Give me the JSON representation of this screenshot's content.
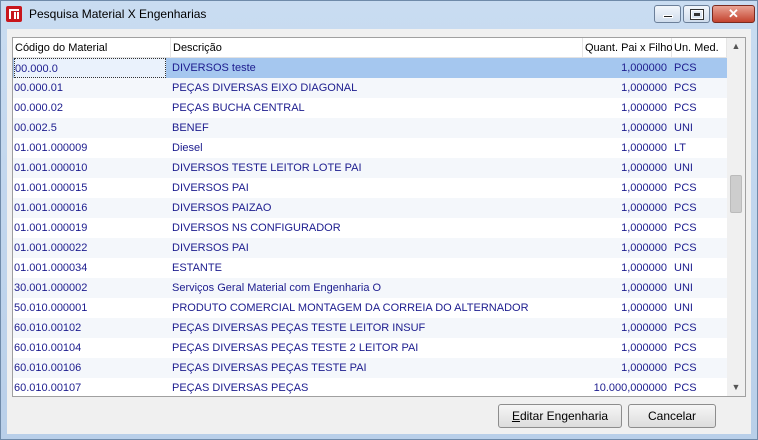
{
  "window": {
    "title": "Pesquisa Material X Engenharias",
    "close_glyph": "✕",
    "icon": "app-logo-icon"
  },
  "columns": {
    "code": "Código do Material",
    "desc": "Descrição",
    "qty": "Quant. Pai x Filho",
    "unit": "Un. Med."
  },
  "rows": [
    {
      "code": "00.000.0",
      "desc": "DIVERSOS teste",
      "qty": "1,000000",
      "unit": "PCS",
      "selected": true
    },
    {
      "code": "00.000.01",
      "desc": "PEÇAS DIVERSAS EIXO DIAGONAL",
      "qty": "1,000000",
      "unit": "PCS"
    },
    {
      "code": "00.000.02",
      "desc": "PEÇAS BUCHA CENTRAL",
      "qty": "1,000000",
      "unit": "PCS"
    },
    {
      "code": "00.002.5",
      "desc": "BENEF",
      "qty": "1,000000",
      "unit": "UNI"
    },
    {
      "code": "01.001.000009",
      "desc": "Diesel",
      "qty": "1,000000",
      "unit": "LT"
    },
    {
      "code": "01.001.000010",
      "desc": "DIVERSOS TESTE LEITOR LOTE PAI",
      "qty": "1,000000",
      "unit": "UNI"
    },
    {
      "code": "01.001.000015",
      "desc": "DIVERSOS PAI",
      "qty": "1,000000",
      "unit": "PCS"
    },
    {
      "code": "01.001.000016",
      "desc": "DIVERSOS PAIZAO",
      "qty": "1,000000",
      "unit": "PCS"
    },
    {
      "code": "01.001.000019",
      "desc": "DIVERSOS NS CONFIGURADOR",
      "qty": "1,000000",
      "unit": "PCS"
    },
    {
      "code": "01.001.000022",
      "desc": "DIVERSOS PAI",
      "qty": "1,000000",
      "unit": "PCS"
    },
    {
      "code": "01.001.000034",
      "desc": "ESTANTE",
      "qty": "1,000000",
      "unit": "UNI"
    },
    {
      "code": "30.001.000002",
      "desc": "Serviços Geral Material com Engenharia O",
      "qty": "1,000000",
      "unit": "UNI"
    },
    {
      "code": "50.010.000001",
      "desc": "PRODUTO COMERCIAL MONTAGEM DA CORREIA DO ALTERNADOR",
      "qty": "1,000000",
      "unit": "UNI"
    },
    {
      "code": "60.010.00102",
      "desc": "PEÇAS DIVERSAS PEÇAS TESTE LEITOR INSUF",
      "qty": "1,000000",
      "unit": "PCS"
    },
    {
      "code": "60.010.00104",
      "desc": "PEÇAS DIVERSAS PEÇAS TESTE 2 LEITOR PAI",
      "qty": "1,000000",
      "unit": "PCS"
    },
    {
      "code": "60.010.00106",
      "desc": "PEÇAS DIVERSAS PEÇAS TESTE PAI",
      "qty": "1,000000",
      "unit": "PCS"
    },
    {
      "code": "60.010.00107",
      "desc": "PEÇAS DIVERSAS PEÇAS",
      "qty": "10.000,000000",
      "unit": "PCS"
    }
  ],
  "scrollbar": {
    "up": "▲",
    "down": "▼",
    "position": 0.42
  },
  "buttons": {
    "edit_mnemonic": "E",
    "edit_rest": "ditar Engenharia",
    "cancel": "Cancelar"
  },
  "colors": {
    "selection": "#a5c7ef",
    "row_text": "#1c1c8e",
    "close_button": "#c4432e"
  }
}
